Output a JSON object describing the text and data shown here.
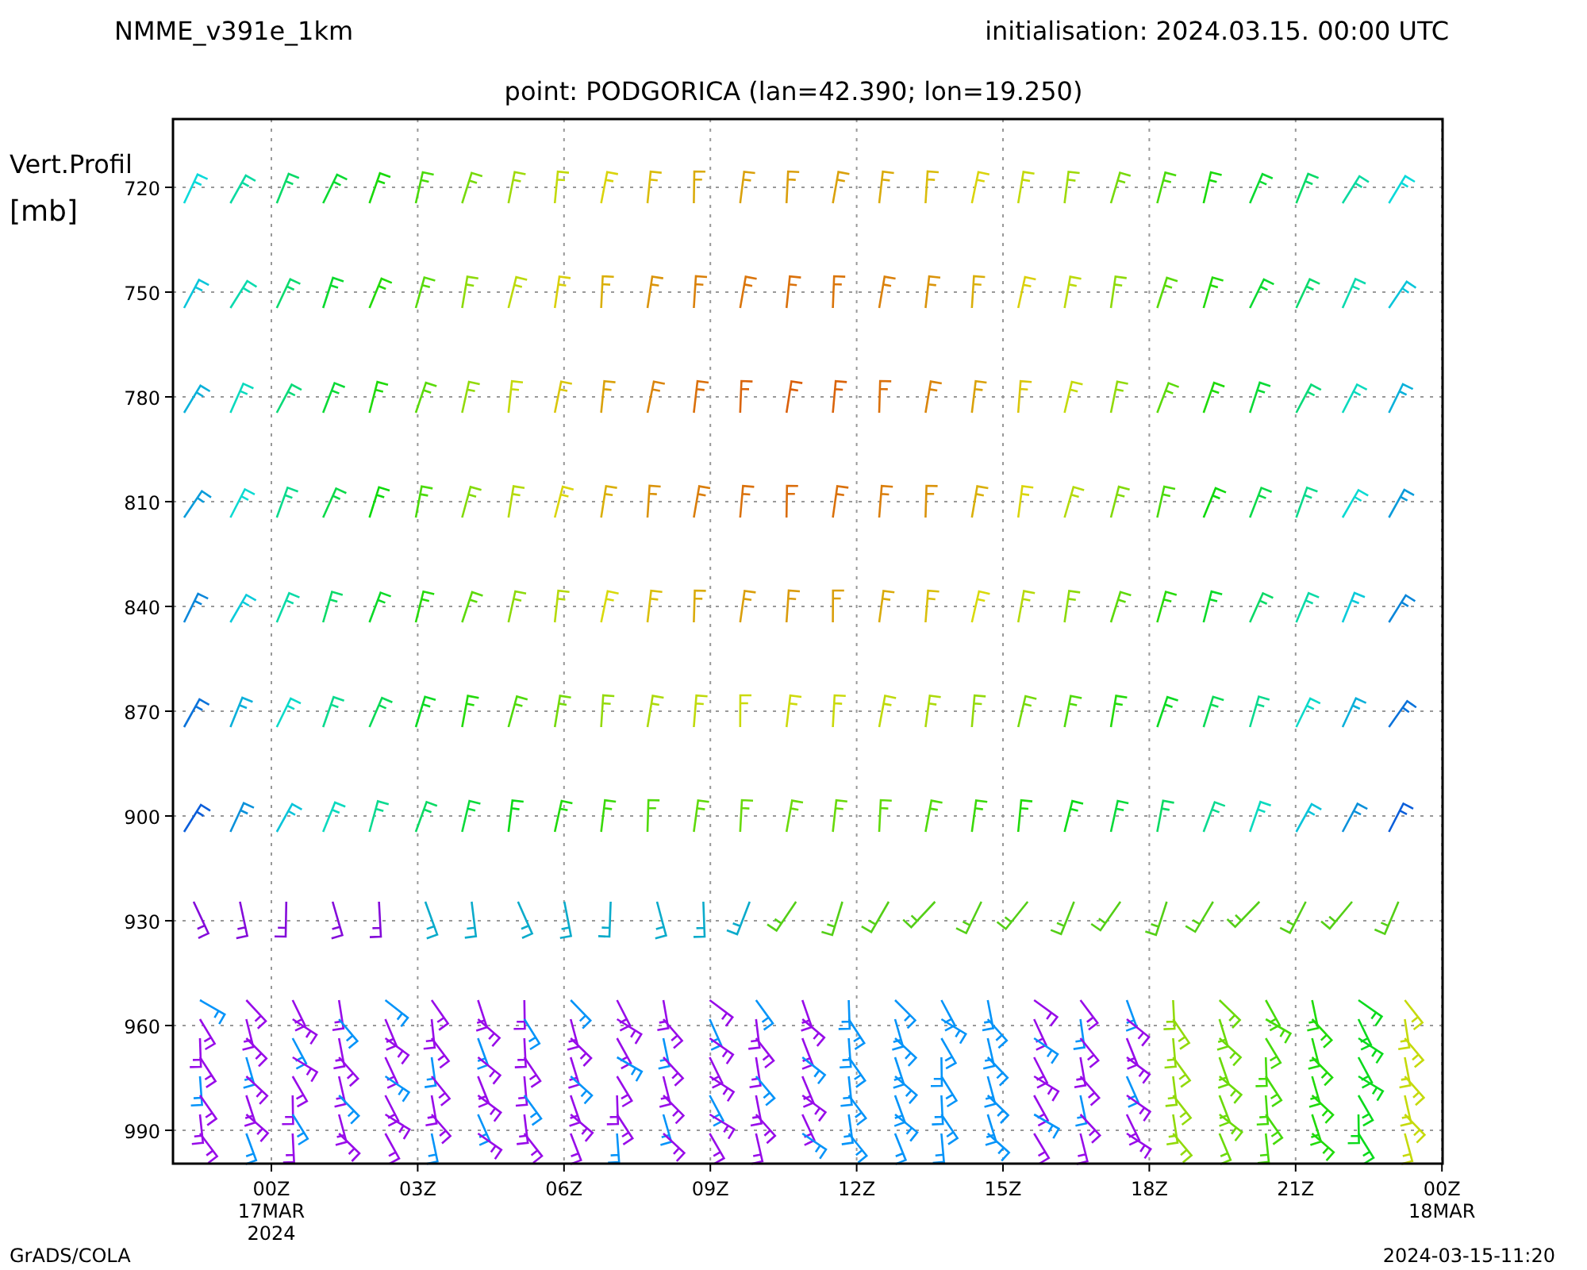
{
  "title_left": "NMME_v391e_1km",
  "title_right": "initialisation: 2024.03.15. 00:00 UTC",
  "subtitle": "point: PODGORICA (lan=42.390; lon=19.250)",
  "y_axis": {
    "title": [
      "Vert.Profil",
      "[mb]"
    ],
    "ticks": [
      "720",
      "750",
      "780",
      "810",
      "840",
      "870",
      "900",
      "930",
      "960",
      "990"
    ]
  },
  "x_axis": {
    "ticks": [
      {
        "lines": [
          "00Z",
          "17MAR",
          "2024"
        ]
      },
      {
        "lines": [
          "03Z"
        ]
      },
      {
        "lines": [
          "06Z"
        ]
      },
      {
        "lines": [
          "09Z"
        ]
      },
      {
        "lines": [
          "12Z"
        ]
      },
      {
        "lines": [
          "15Z"
        ]
      },
      {
        "lines": [
          "18Z"
        ]
      },
      {
        "lines": [
          "21Z"
        ]
      },
      {
        "lines": [
          "00Z",
          "18MAR"
        ]
      }
    ]
  },
  "footer_left": "GrADS/COLA",
  "footer_right": "2024-03-15-11:20"
}
